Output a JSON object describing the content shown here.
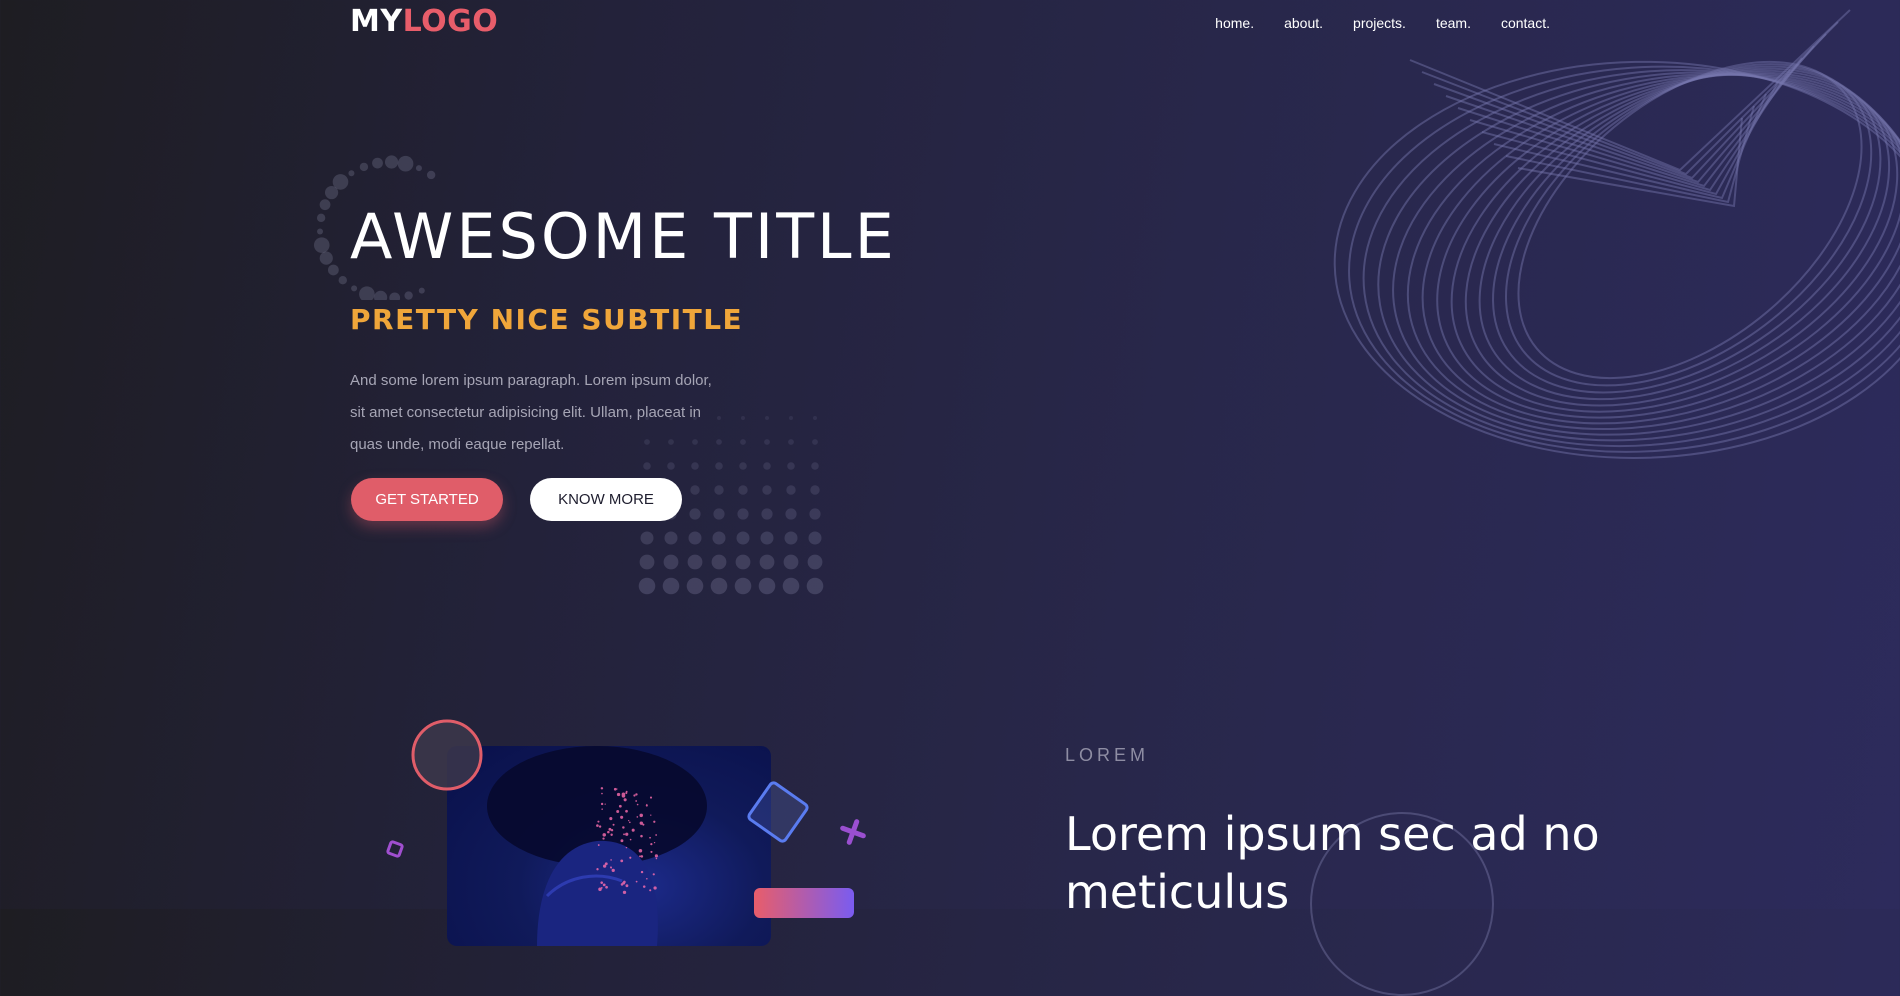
{
  "logo": {
    "part1": "MY",
    "part2": "LOGO"
  },
  "nav": {
    "items": [
      "home.",
      "about.",
      "projects.",
      "team.",
      "contact."
    ]
  },
  "hero": {
    "title": "AWESOME TITLE",
    "subtitle": "PRETTY NICE SUBTITLE",
    "paragraph": "And some lorem ipsum paragraph. Lorem ipsum dolor, sit amet consectetur adipisicing elit. Ullam, placeat in quas unde, modi eaque repellat.",
    "primary_button": "GET STARTED",
    "secondary_button": "KNOW MORE"
  },
  "section": {
    "eyebrow": "LOREM",
    "title": "Lorem ipsum sec ad no meticulus"
  },
  "colors": {
    "accent": "#e85d6a",
    "subtitle": "#f0a63a",
    "background": "#23223a"
  },
  "icons": {
    "spiral": "wireframe-spiral-decoration",
    "dot_ring": "dotted-ring-decoration",
    "dot_grid": "dot-grid-decoration"
  }
}
